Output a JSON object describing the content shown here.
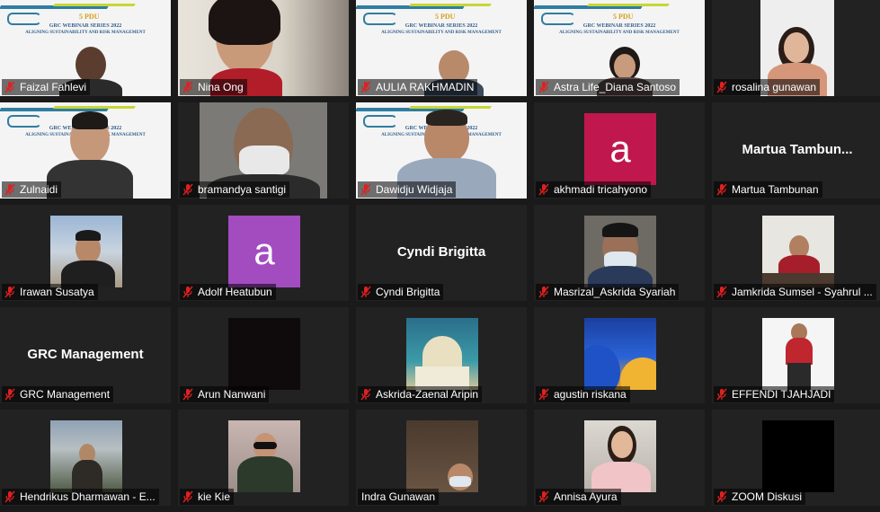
{
  "slide": {
    "pdu": "5 PDU",
    "title": "GRC WEBINAR SERIES 2022",
    "subtitle": "ALIGNING SUSTAINABILITY AND RISK MANAGEMENT",
    "logo_right": "LSPMR"
  },
  "participants": [
    {
      "name": "Faizal Fahlevi",
      "type": "slide",
      "muted": true
    },
    {
      "name": "Nina Ong",
      "type": "video",
      "muted": true
    },
    {
      "name": "AULIA RAKHMADIN",
      "type": "slide",
      "muted": true
    },
    {
      "name": "Astra Life_Diana Santoso",
      "type": "slide",
      "muted": true
    },
    {
      "name": "rosalina gunawan",
      "type": "video",
      "muted": true
    },
    {
      "name": "Zulnaidi",
      "type": "slide",
      "muted": true
    },
    {
      "name": "bramandya santigi",
      "type": "video",
      "muted": true
    },
    {
      "name": "Dawidju Widjaja",
      "type": "slide",
      "muted": true
    },
    {
      "name": "akhmadi tricahyono",
      "type": "avatar",
      "letter": "a",
      "color": "#c0174f",
      "muted": true
    },
    {
      "name": "Martua Tambunan",
      "type": "text",
      "display": "Martua  Tambun...",
      "muted": true
    },
    {
      "name": "Irawan Susatya",
      "type": "photo",
      "muted": true
    },
    {
      "name": "Adolf Heatubun",
      "type": "avatar",
      "letter": "a",
      "color": "#a24cc0",
      "muted": true
    },
    {
      "name": "Cyndi Brigitta",
      "type": "text",
      "display": "Cyndi Brigitta",
      "muted": true
    },
    {
      "name": "Masrizal_Askrida Syariah",
      "type": "photo",
      "muted": true
    },
    {
      "name": "Jamkrida Sumsel - Syahrul ...",
      "type": "photo",
      "muted": true
    },
    {
      "name": "GRC Management",
      "type": "text",
      "display": "GRC Management",
      "muted": true
    },
    {
      "name": "Arun Nanwani",
      "type": "dark",
      "muted": true
    },
    {
      "name": "Askrida-Zaenal Aripin",
      "type": "photo",
      "muted": true
    },
    {
      "name": "agustin riskana",
      "type": "photo",
      "muted": true
    },
    {
      "name": "EFFENDI TJAHJADI",
      "type": "photo",
      "muted": true
    },
    {
      "name": "Hendrikus Dharmawan - E...",
      "type": "photo",
      "muted": true
    },
    {
      "name": "kie Kie",
      "type": "photo",
      "muted": true
    },
    {
      "name": "Indra Gunawan",
      "type": "photo",
      "muted": false
    },
    {
      "name": "Annisa Ayura",
      "type": "photo",
      "muted": true
    },
    {
      "name": "ZOOM Diskusi",
      "type": "dark",
      "muted": true
    }
  ]
}
